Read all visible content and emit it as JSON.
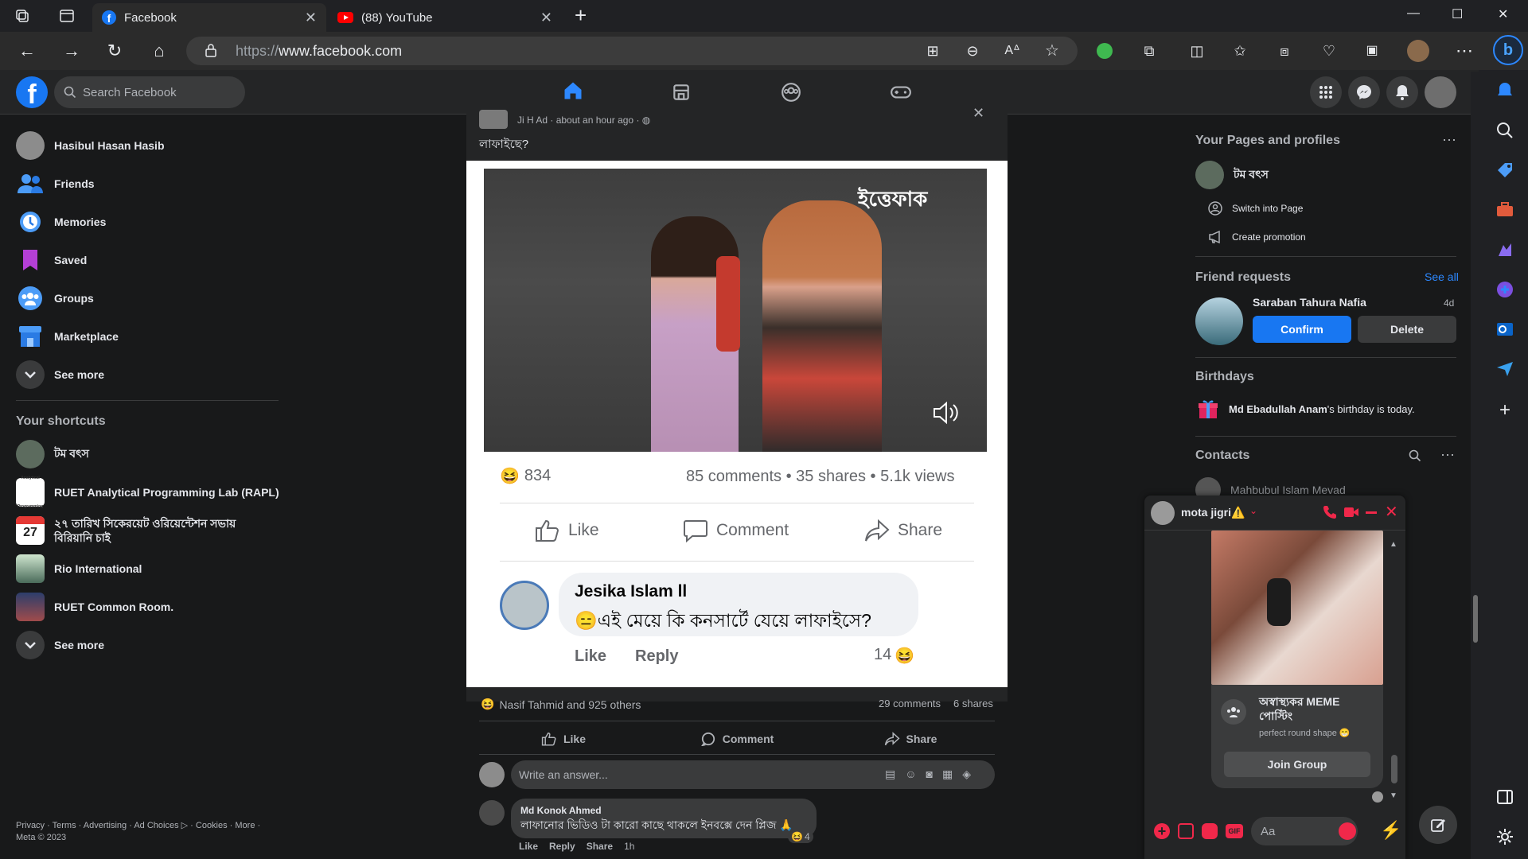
{
  "browser": {
    "tabs": [
      {
        "title": "Facebook",
        "close": "✕"
      },
      {
        "title": "(88) YouTube",
        "close": "✕"
      }
    ],
    "new_tab": "+",
    "url_prefix": "https://",
    "url_domain": "www.facebook.com",
    "window_controls": {
      "minimize": "—",
      "maximize": "☐",
      "close": "✕"
    }
  },
  "fb": {
    "logo": "f",
    "search_placeholder": "Search Facebook",
    "nav_tabs": [
      "home-icon",
      "marketplace-icon",
      "groups-icon",
      "gaming-icon"
    ],
    "active_tab": "home-icon"
  },
  "left": {
    "profile_name": "Hasibul Hasan Hasib",
    "items": [
      "Friends",
      "Memories",
      "Saved",
      "Groups",
      "Marketplace",
      "See more"
    ],
    "shortcuts_title": "Your shortcuts",
    "shortcuts": [
      "টম বৎস",
      "RUET Analytical Programming Lab (RAPL)",
      "২৭ তারিখ সিকেরয়েট ওরিয়েন্টেশন সভায় বিরিয়ানি চাই",
      "Rio International",
      "RUET Common Room.",
      "See more"
    ],
    "calendar_day": "27",
    "footer_line1": "Privacy · Terms · Advertising · Ad Choices ▷ · Cookies · More ·",
    "footer_line2": "Meta © 2023"
  },
  "post": {
    "author": "Ji H Ad",
    "time": "· about an hour ago ·",
    "text": "লাফাইছে?",
    "image": {
      "watermark": "ইত্তেফাক",
      "reactions": "834",
      "stats": "85 comments • 35 shares • 5.1k views",
      "like": "Like",
      "comment": "Comment",
      "share": "Share",
      "commenter": "Jesika Islam ll",
      "comment_text": "😑এই মেয়ে কি কনসার্টে যেয়ে লাফাইসে?",
      "comment_like": "Like",
      "comment_reply": "Reply",
      "comment_count": "14"
    },
    "reaction_summary": "Nasif Tahmid and 925 others",
    "comments_count": "29 comments",
    "shares_count": "6 shares",
    "like": "Like",
    "comment": "Comment",
    "share": "Share",
    "write_placeholder": "Write an answer...",
    "reply_author": "Md Konok Ahmed",
    "reply_text": "লাফানোর ভিডিও টা কারো কাছে থাকলে ইনবক্সে দেন প্লিজ 🙏",
    "reply_reactions": "4",
    "reply_like": "Like",
    "reply_reply": "Reply",
    "reply_share": "Share",
    "reply_time": "1h"
  },
  "right": {
    "pages_title": "Your Pages and profiles",
    "page_name": "টম বৎস",
    "switch_page": "Switch into Page",
    "create_promotion": "Create promotion",
    "friend_requests_title": "Friend requests",
    "see_all": "See all",
    "request_name": "Saraban Tahura Nafia",
    "request_age": "4d",
    "confirm": "Confirm",
    "delete": "Delete",
    "birthdays_title": "Birthdays",
    "birthday_name": "Md Ebadullah Anam",
    "birthday_rest": "'s birthday is today.",
    "contacts_title": "Contacts",
    "contact_1": "Mahbubul Islam Mevad"
  },
  "chat": {
    "name": "mota jigri⚠️",
    "group_name": "অস্বাস্থ্যকর MEME পোস্টিং",
    "group_sub": "perfect round shape 😁",
    "join": "Join Group",
    "input_placeholder": "Aa"
  },
  "colors": {
    "fb_blue": "#1877f2",
    "accent_blue": "#2d88ff",
    "chat_red": "#f0284a",
    "bg": "#18191a",
    "card": "#242526"
  }
}
